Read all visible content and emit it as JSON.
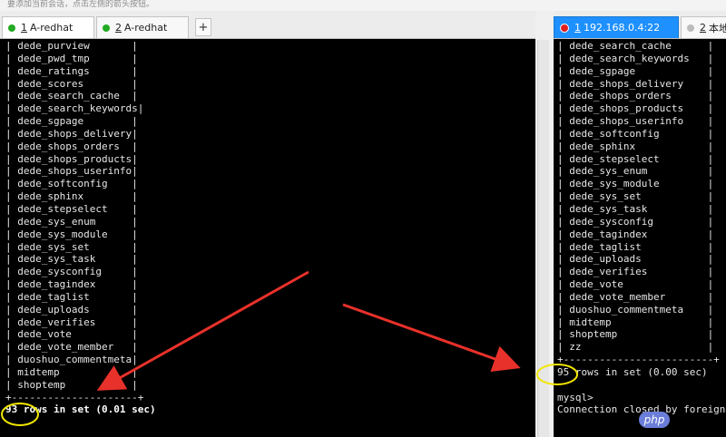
{
  "top_hint": "要添加当前会话，点击左侧的箭头按钮。",
  "left_tabs": [
    {
      "num": "1",
      "label": "A-redhat",
      "dot_color": "#22aa22",
      "active": true
    },
    {
      "num": "2",
      "label": "A-redhat",
      "dot_color": "#22aa22",
      "active": false
    }
  ],
  "add_tab_label": "+",
  "right_tabs": [
    {
      "num": "1",
      "label": "192.168.0.4:22",
      "dot_color": "#e02020",
      "active": true
    },
    {
      "num": "2",
      "label": "本地",
      "dot_color": "#bbbbbb",
      "active": false
    }
  ],
  "left_terminal": {
    "table_names": [
      "dede_purview",
      "dede_pwd_tmp",
      "dede_ratings",
      "dede_scores",
      "dede_search_cache",
      "dede_search_keywords",
      "dede_sgpage",
      "dede_shops_delivery",
      "dede_shops_orders",
      "dede_shops_products",
      "dede_shops_userinfo",
      "dede_softconfig",
      "dede_sphinx",
      "dede_stepselect",
      "dede_sys_enum",
      "dede_sys_module",
      "dede_sys_set",
      "dede_sys_task",
      "dede_sysconfig",
      "dede_tagindex",
      "dede_taglist",
      "dede_uploads",
      "dede_verifies",
      "dede_vote",
      "dede_vote_member",
      "duoshuo_commentmeta",
      "midtemp",
      "shoptemp"
    ],
    "border_line": "+---------------------+",
    "result_line": "93 rows in set (0.01 sec)"
  },
  "right_terminal": {
    "table_names": [
      "dede_search_cache",
      "dede_search_keywords",
      "dede_sgpage",
      "dede_shops_delivery",
      "dede_shops_orders",
      "dede_shops_products",
      "dede_shops_userinfo",
      "dede_softconfig",
      "dede_sphinx",
      "dede_stepselect",
      "dede_sys_enum",
      "dede_sys_module",
      "dede_sys_set",
      "dede_sys_task",
      "dede_sysconfig",
      "dede_tagindex",
      "dede_taglist",
      "dede_uploads",
      "dede_verifies",
      "dede_vote",
      "dede_vote_member",
      "duoshuo_commentmeta",
      "midtemp",
      "shoptemp",
      "zz"
    ],
    "border_line": "+-------------------------+",
    "result_line": "95 rows in set (0.00 sec)",
    "prompt": "mysql>",
    "message": "Connection closed by foreign"
  },
  "watermark": "php",
  "colors": {
    "arrow": "#e8312a",
    "highlight_circle": "#f2e600",
    "terminal_bg": "#000000",
    "terminal_text": "#e6e6e6"
  }
}
